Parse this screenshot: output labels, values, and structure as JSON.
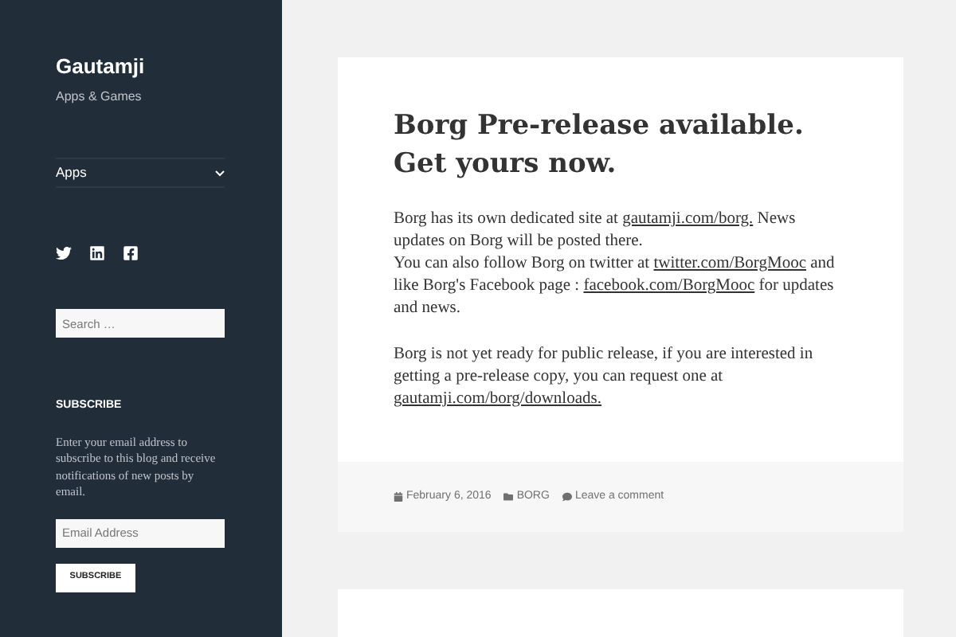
{
  "site": {
    "title": "Gautamji",
    "tagline": "Apps & Games"
  },
  "menu": [
    {
      "label": "Apps",
      "expanded": false
    }
  ],
  "search": {
    "placeholder": "Search …"
  },
  "subscribe": {
    "heading": "SUBSCRIBE",
    "text": "Enter your email address to subscribe to this blog and receive notifications of new posts by email.",
    "placeholder": "Email Address",
    "button": "SUBSCRIBE"
  },
  "post": {
    "title": "Borg Pre-release available. Get yours now.",
    "paragraphs": [
      [
        {
          "kind": "text",
          "text": "Borg has its own dedicated site at "
        },
        {
          "kind": "link",
          "text": "gautamji.com/borg."
        },
        {
          "kind": "text",
          "text": " News updates on Borg will be posted there."
        },
        {
          "kind": "break"
        },
        {
          "kind": "text",
          "text": "You can also follow Borg on twitter at "
        },
        {
          "kind": "link",
          "text": "twitter.com/BorgMooc"
        },
        {
          "kind": "text",
          "text": " and like Borg's Facebook page : "
        },
        {
          "kind": "link",
          "text": "facebook.com/BorgMooc"
        },
        {
          "kind": "text",
          "text": " for updates and news."
        }
      ],
      [
        {
          "kind": "text",
          "text": "Borg is not yet ready for public release, if you are interested in getting a pre-release copy, you can request one at "
        },
        {
          "kind": "link",
          "text": "gautamji.com/borg/downloads."
        }
      ]
    ],
    "meta": {
      "date": "February 6, 2016",
      "category": "BORG",
      "comments": "Leave a comment"
    }
  }
}
